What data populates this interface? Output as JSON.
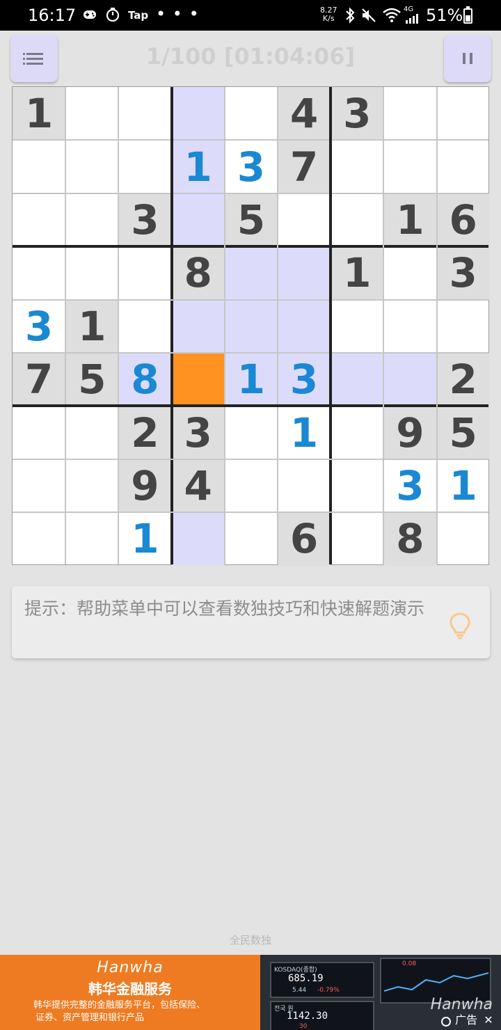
{
  "status_bar": {
    "time": "16:17",
    "app_label": "Tap",
    "more": "• • •",
    "net_speed_value": "8.27",
    "net_speed_unit": "K/s",
    "network": "4G",
    "battery": "51%"
  },
  "toolbar": {
    "title": "1/100 [01:04:06]",
    "menu_icon": "list-icon",
    "pause_icon": "pause-icon"
  },
  "board": {
    "given_color": "#444444",
    "user_color": "#1a88d3",
    "highlight_color": "#dcdcfa",
    "selected_color": "#ff9220",
    "selected": [
      5,
      3
    ],
    "grid": [
      [
        "1",
        "",
        "",
        "",
        "",
        "4",
        "3",
        "",
        ""
      ],
      [
        "",
        "",
        "",
        "1",
        "3",
        "7",
        "",
        "",
        ""
      ],
      [
        "",
        "",
        "3",
        "",
        "5",
        "",
        "",
        "1",
        "6"
      ],
      [
        "",
        "",
        "",
        "8",
        "",
        "",
        "1",
        "",
        "3"
      ],
      [
        "3",
        "1",
        "",
        "",
        "",
        "",
        "",
        "",
        ""
      ],
      [
        "7",
        "5",
        "8",
        "",
        "1",
        "3",
        "",
        "",
        "2"
      ],
      [
        "",
        "",
        "2",
        "3",
        "",
        "1",
        "",
        "9",
        "5"
      ],
      [
        "",
        "",
        "9",
        "4",
        "",
        "",
        "",
        "3",
        "1"
      ],
      [
        "",
        "",
        "1",
        "",
        "",
        "6",
        "",
        "8",
        ""
      ]
    ],
    "user_entries": [
      [
        1,
        3
      ],
      [
        1,
        4
      ],
      [
        4,
        0
      ],
      [
        5,
        2
      ],
      [
        5,
        4
      ],
      [
        5,
        5
      ],
      [
        6,
        5
      ],
      [
        7,
        7
      ],
      [
        7,
        8
      ],
      [
        8,
        2
      ]
    ]
  },
  "hint": {
    "text": "提示：帮助菜单中可以查看数独技巧和快速解题演示",
    "icon": "lightbulb-icon"
  },
  "footer": {
    "app_name": "全民数独"
  },
  "ad": {
    "brand": "Hanwha",
    "headline": "韩华金融服务",
    "description_line1": "韩华提供完整的金融服务平台，包括保险、",
    "description_line2": "证券、资产管理和银行产品",
    "screen_index_label": "KOSDAQ(종합)",
    "screen_value1": "685.19",
    "screen_change1": "5.44",
    "screen_pct1": "-0.79%",
    "screen_value2": "1142.30",
    "screen_small2": "30",
    "screen_top": "0.08",
    "screen_label2": "전국 원",
    "ad_label": "广告",
    "watermark": "Hanwha",
    "close": "✕"
  }
}
